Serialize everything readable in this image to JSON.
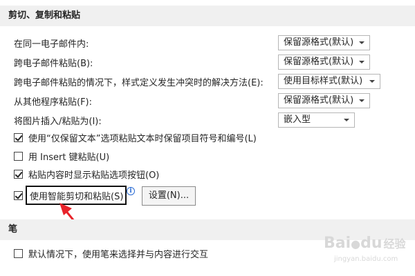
{
  "section_cut_copy_paste": {
    "title": "剪切、复制和粘贴",
    "rows": [
      {
        "label": "在同一电子邮件内:",
        "value": "保留源格式(默认)"
      },
      {
        "label": "跨电子邮件粘贴(B):",
        "value": "保留源格式(默认)"
      },
      {
        "label": "跨电子邮件粘贴的情况下，样式定义发生冲突时的解决方法(E):",
        "value": "使用目标样式(默认)"
      },
      {
        "label": "从其他程序粘贴(F):",
        "value": "保留源格式(默认)"
      },
      {
        "label": "将图片插入/粘贴为(I):",
        "value": "嵌入型"
      }
    ],
    "checkboxes": [
      {
        "label": "使用“仅保留文本”选项粘贴文本时保留项目符号和编号(L)",
        "checked": true
      },
      {
        "label": "用 Insert 键粘贴(U)",
        "checked": false
      },
      {
        "label": "粘贴内容时显示粘贴选项按钮(O)",
        "checked": true
      },
      {
        "label": "使用智能剪切和粘贴(S)",
        "checked": true
      }
    ],
    "settings_button": "设置(N)..."
  },
  "section_pen": {
    "title": "笔",
    "checkboxes": [
      {
        "label": "默认情况下，使用笔来选择并与内容进行交互",
        "checked": false
      }
    ]
  },
  "annotation": {
    "arrow_color": "#e8232a"
  },
  "watermark": {
    "brand": "Bai",
    "paw": "du",
    "suffix": "经验",
    "url": "jingyan.baidu.com"
  },
  "colors": {
    "header_bg": "#f0f0f0",
    "info_blue": "#2b6cd4"
  }
}
